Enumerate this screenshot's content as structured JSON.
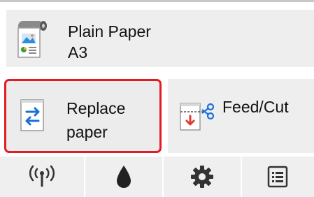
{
  "paper_info": {
    "type": "Plain Paper",
    "size": "A3",
    "icon": "paper-roll-icon"
  },
  "actions": {
    "replace": {
      "label": "Replace\npaper",
      "icon": "replace-paper-icon"
    },
    "feed_cut": {
      "label": "Feed/Cut",
      "icon": "feed-cut-icon"
    }
  },
  "toolbar": {
    "items": [
      {
        "name": "network",
        "icon": "wireless-network-icon"
      },
      {
        "name": "ink",
        "icon": "ink-drop-icon"
      },
      {
        "name": "settings",
        "icon": "gear-icon"
      },
      {
        "name": "job-list",
        "icon": "list-icon"
      }
    ]
  },
  "colors": {
    "highlight_border": "#e21b24",
    "button_bg": "#eeeeee",
    "arrow_blue": "#1a6fd9",
    "cut_red": "#e03a2e"
  }
}
